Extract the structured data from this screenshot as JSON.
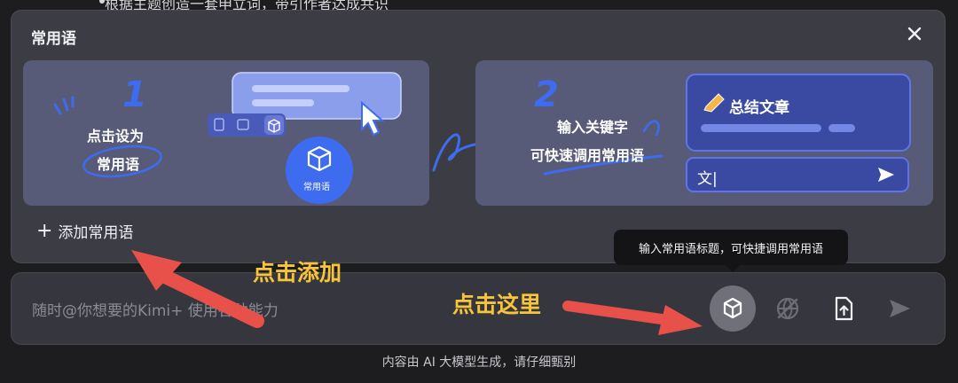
{
  "background": {
    "snippet": "根据主题创造一套申立词，带引作者达成共识"
  },
  "panel": {
    "title": "常用语",
    "close_icon": "close-icon",
    "add_label": "添加常用语"
  },
  "card_left": {
    "step": "1",
    "line1": "点击设为",
    "line2": "常用语",
    "button_label": "常用语"
  },
  "card_right": {
    "step": "2",
    "line1": "输入关键字",
    "line2": "可快速调用常用语",
    "preview_title": "总结文章",
    "input_value": "文|"
  },
  "tooltip": "输入常用语标题，可快捷调用常用语",
  "input": {
    "placeholder": "随时@你想要的Kimi+ 使用各种能力"
  },
  "toolbar": {
    "icons": [
      "cube-icon",
      "globe-off-icon",
      "file-upload-icon",
      "send-icon"
    ]
  },
  "footer": "内容由 AI 大模型生成，请仔细甄别",
  "annotations": {
    "add": "点击添加",
    "here": "点击这里"
  },
  "colors": {
    "accent_blue": "#3d6cf0",
    "annotation_yellow": "#f7c43a",
    "arrow_red": "#e8504a"
  }
}
